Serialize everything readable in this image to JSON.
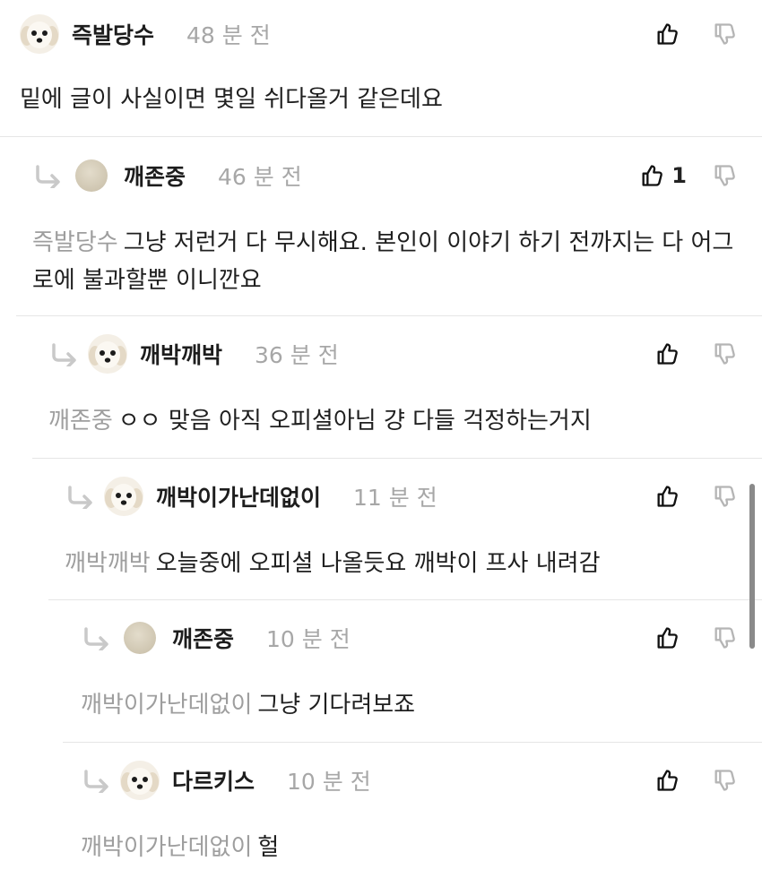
{
  "comments": [
    {
      "nickname": "즉발당수",
      "time": "48 분 전",
      "avatar": "dog",
      "likes": "",
      "mention": "",
      "text": "밑에 글이 사실이면 몇일 쉬다올거 같은데요"
    },
    {
      "nickname": "깨존중",
      "time": "46 분 전",
      "avatar": "plain",
      "likes": "1",
      "mention": "즉발당수",
      "text": "그냥 저런거 다 무시해요. 본인이 이야기 하기 전까지는 다 어그로에 불과할뿐 이니깐요"
    },
    {
      "nickname": "깨박깨박",
      "time": "36 분 전",
      "avatar": "dog",
      "likes": "",
      "mention": "깨존중",
      "text": "ㅇㅇ 맞음 아직 오피셜아님 걍 다들 걱정하는거지"
    },
    {
      "nickname": "깨박이가난데없이",
      "time": "11 분 전",
      "avatar": "dog",
      "likes": "",
      "mention": "깨박깨박",
      "text": "오늘중에 오피셜 나올듯요 깨박이 프사 내려감"
    },
    {
      "nickname": "깨존중",
      "time": "10 분 전",
      "avatar": "plain",
      "likes": "",
      "mention": "깨박이가난데없이",
      "text": "그냥 기다려보죠"
    },
    {
      "nickname": "다르키스",
      "time": "10 분 전",
      "avatar": "dog",
      "likes": "",
      "mention": "깨박이가난데없이",
      "text": "헐"
    }
  ]
}
